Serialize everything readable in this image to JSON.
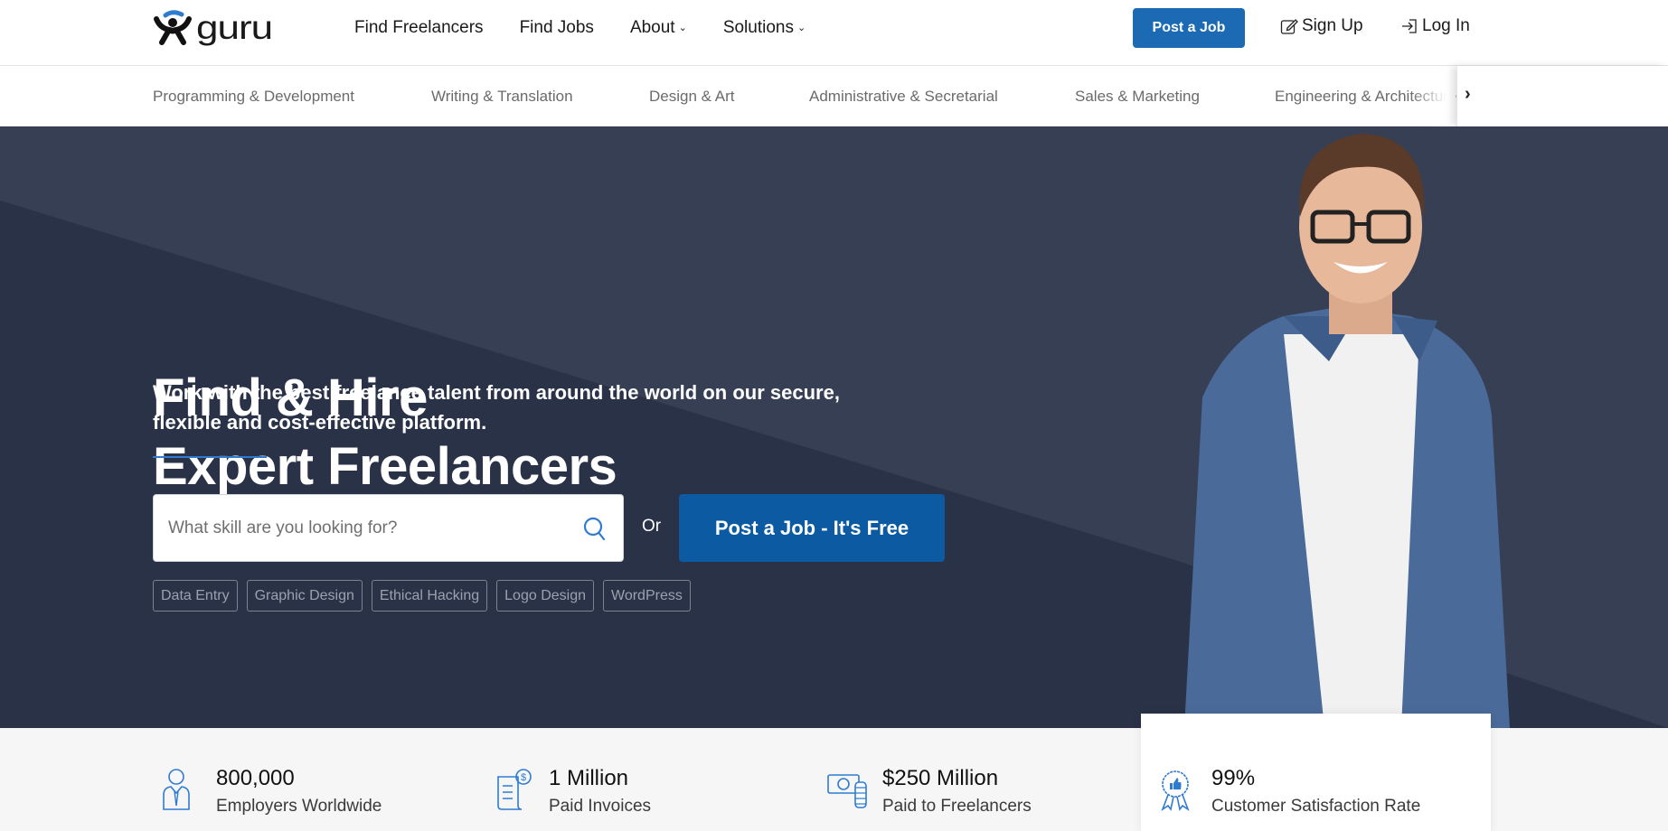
{
  "header": {
    "logo_text": "guru",
    "nav": [
      {
        "label": "Find Freelancers",
        "dropdown": false
      },
      {
        "label": "Find Jobs",
        "dropdown": false
      },
      {
        "label": "About",
        "dropdown": true
      },
      {
        "label": "Solutions",
        "dropdown": true
      }
    ],
    "post_job_label": "Post a Job",
    "sign_up_label": "Sign Up",
    "log_in_label": "Log In"
  },
  "categories": [
    "Programming & Development",
    "Writing & Translation",
    "Design & Art",
    "Administrative & Secretarial",
    "Sales & Marketing",
    "Engineering & Architecture"
  ],
  "hero": {
    "title_line1": "Find & Hire",
    "title_line2": "Expert Freelancers",
    "subtitle": "Work with the best freelance talent from around the world on our secure, flexible and cost-effective platform.",
    "search_placeholder": "What skill are you looking for?",
    "or_label": "Or",
    "cta_label": "Post a Job - It's Free",
    "tags": [
      "Data Entry",
      "Graphic Design",
      "Ethical Hacking",
      "Logo Design",
      "WordPress"
    ]
  },
  "stats": [
    {
      "value": "800,000",
      "label": "Employers Worldwide",
      "icon": "employer-icon"
    },
    {
      "value": "1 Million",
      "label": "Paid Invoices",
      "icon": "invoice-icon"
    },
    {
      "value": "$250 Million",
      "label": "Paid to Freelancers",
      "icon": "money-icon"
    },
    {
      "value": "99%",
      "label": "Customer Satisfaction Rate",
      "icon": "award-icon"
    }
  ],
  "colors": {
    "brand_blue": "#1b6ab3",
    "cta_blue": "#0b5aa2",
    "hero_bg": "#2a3248",
    "accent": "#2f7bd0"
  }
}
